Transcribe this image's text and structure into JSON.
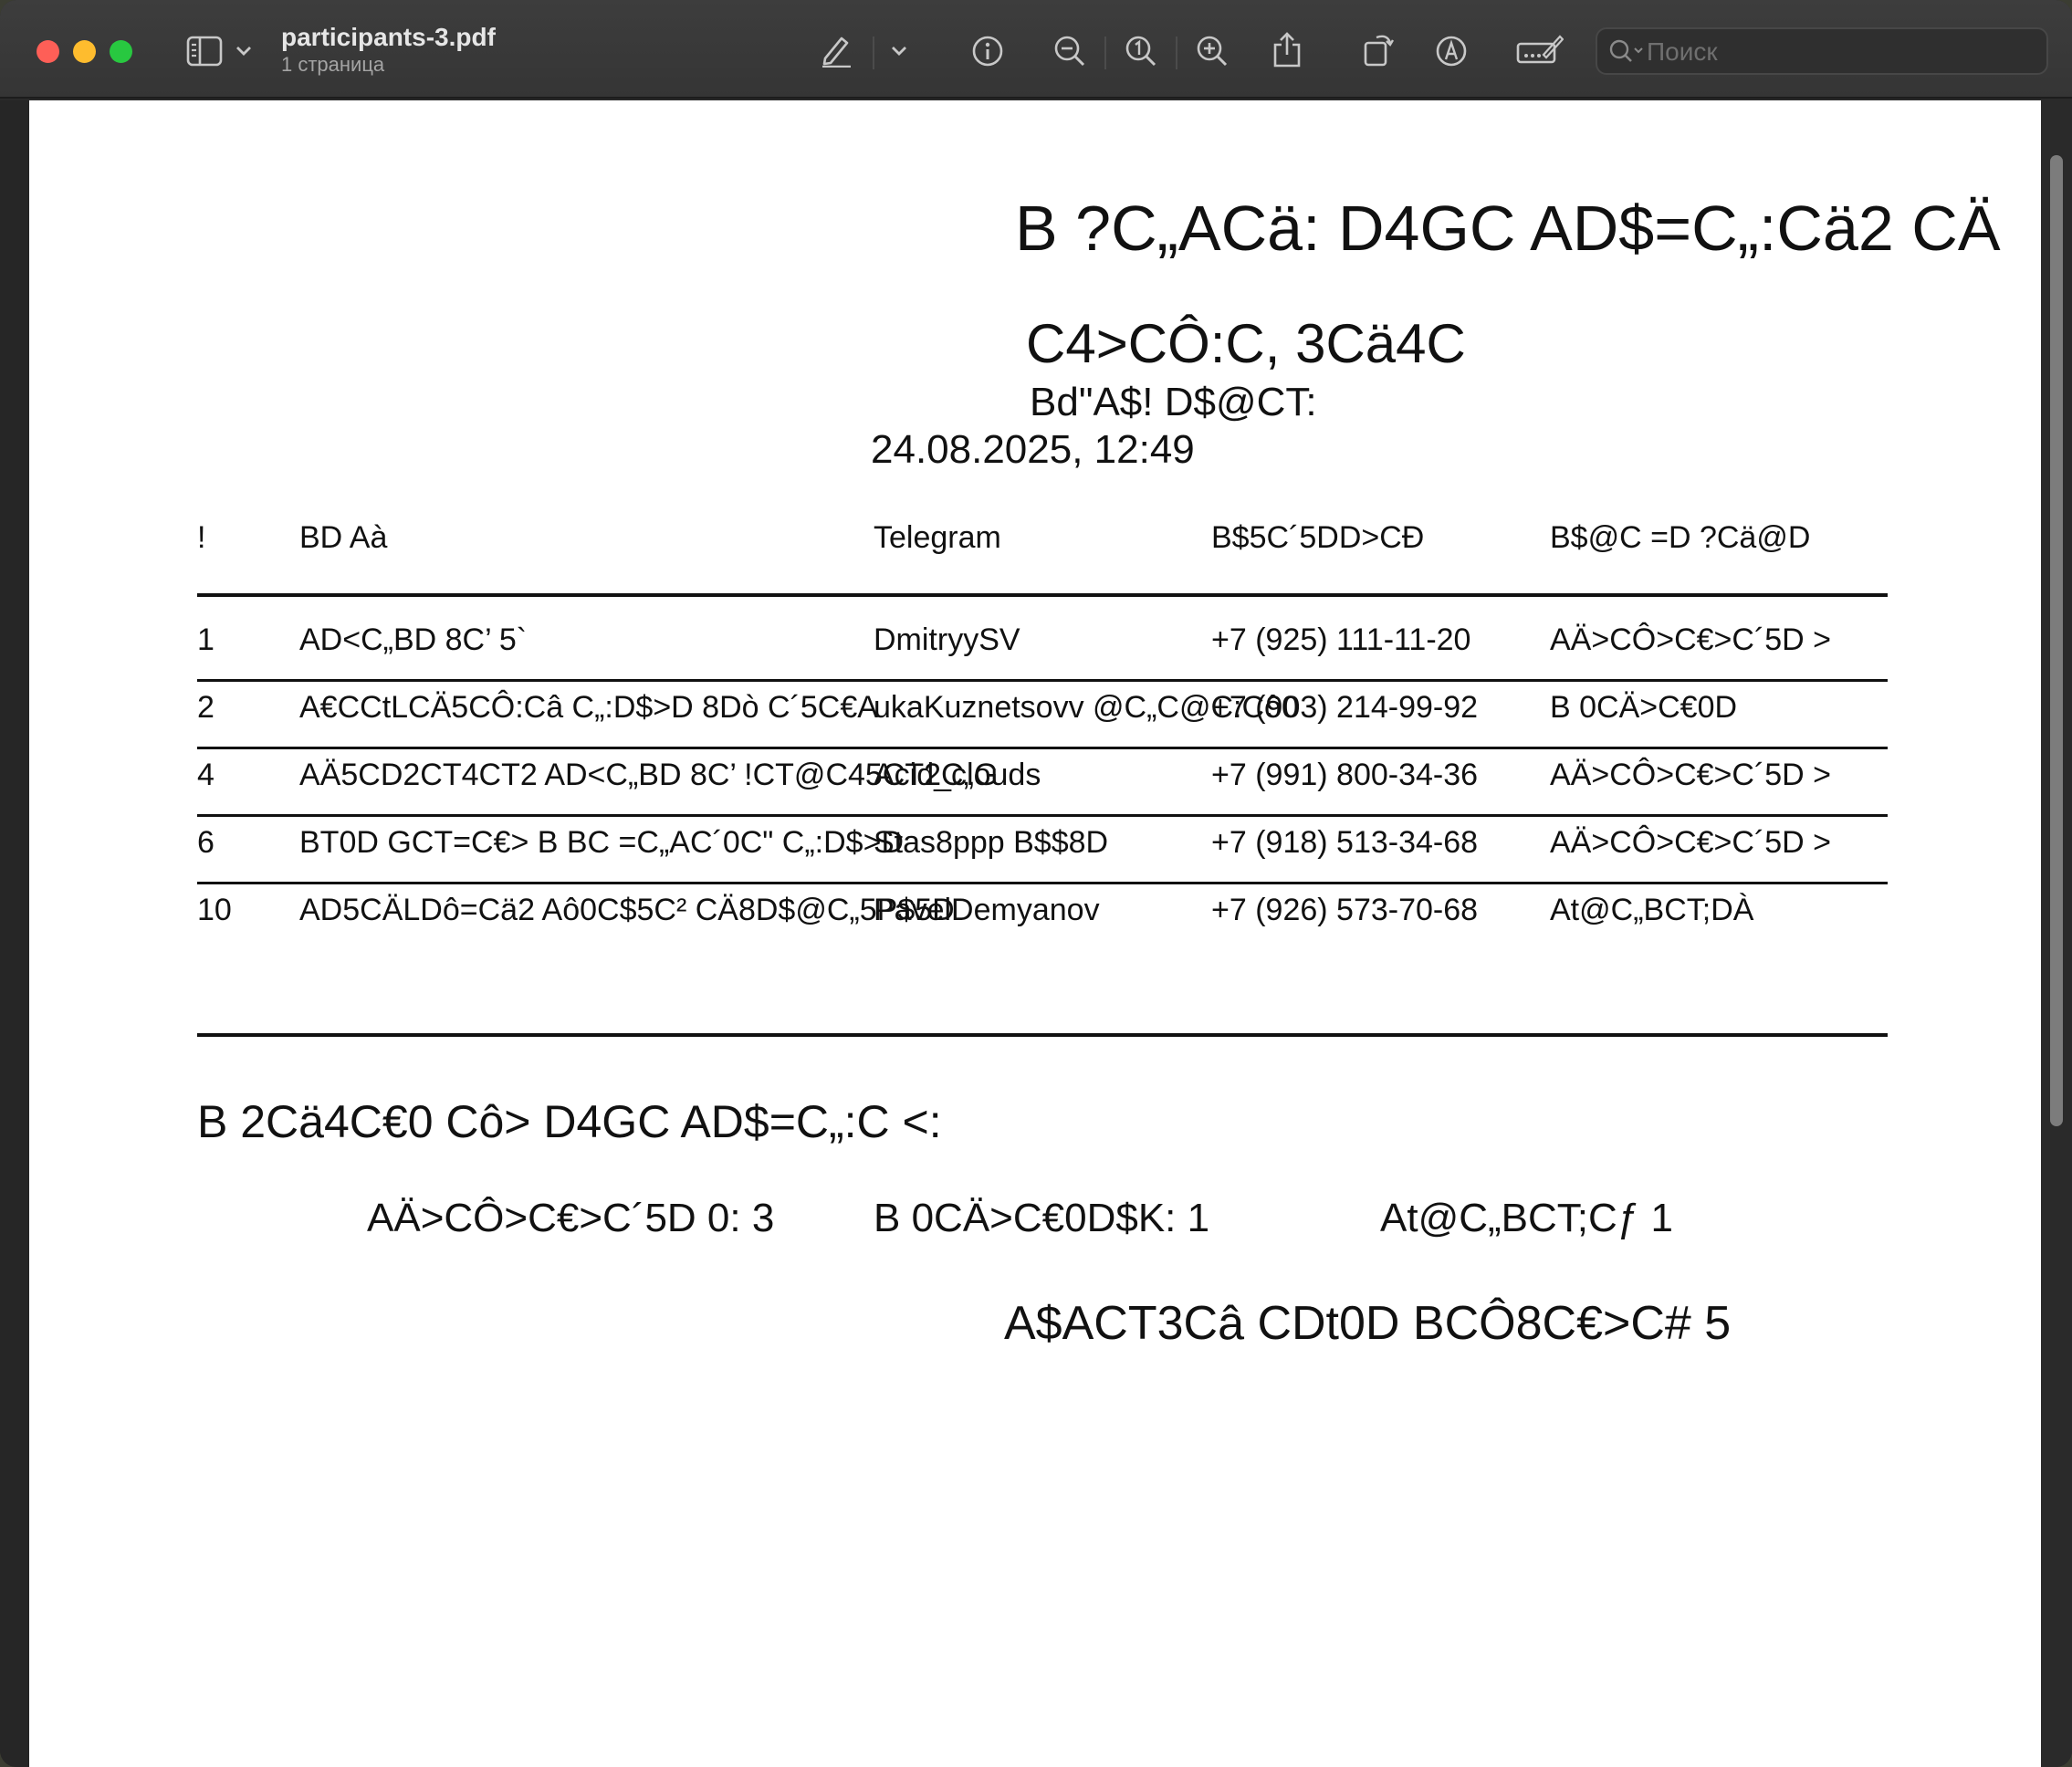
{
  "window": {
    "doc_title": "participants-3.pdf",
    "doc_subtitle": "1 страница"
  },
  "search": {
    "placeholder": "Поиск"
  },
  "toolbar_icons": [
    "sidebar-icon",
    "chevron-down-icon",
    "markup-pen-icon",
    "chevron-down-icon",
    "info-icon",
    "zoom-out-icon",
    "actual-size-icon",
    "zoom-in-icon",
    "share-icon",
    "rotate-icon",
    "markup-icon",
    "form-fill-icon"
  ],
  "document": {
    "title": "B ?C„ACä: D4GC AD$=C„:Cä2 CÄ",
    "subtitle": "C4>CÔ:C, 3Cä4C",
    "generated_label": "Bd\"A$! D$@CT:",
    "generated_datetime": "24.08.2025, 12:49",
    "table": {
      "headers": [
        "!",
        "BD Aà",
        "Telegram",
        "B$5C´5DD>CĐ",
        "B$@C =D ?Cä@D"
      ],
      "rows": [
        [
          "1",
          "AD<C„BD 8C’ 5`",
          "DmitryySV",
          "+7 (925) 111-11-20",
          "AÄ>CÔ>C€>C´5D >"
        ],
        [
          "2",
          "A€CCtLCÄ5CÔ:Câ  C„:D$>D 8Dò  C´5C€A",
          "ukaKuznetsovv  @C„C@C:Cô0",
          "+7 (903) 214-99-92",
          "B 0CÄ>C€0D"
        ],
        [
          "4",
          "AÄ5CD2CT4CT2 AD<C„BD 8C’ !CT@C45CT2C„G",
          "Acid_clouds",
          "+7 (991) 800-34-36",
          "AÄ>CÔ>C€>C´5D >"
        ],
        [
          "6",
          "BT0D GCT=C€> B BC =C„AC´0C\"  C„:D$>D",
          "Stas8ppp  B$$8D",
          "+7 (918) 513-34-68",
          "AÄ>CÔ>C€>C´5D >"
        ],
        [
          "10",
          "AD5CÄLDô=Cä2 Aô0C$5C²  CÄ8D$@C„5P$5D",
          "PavelDemyanov",
          "+7 (926) 573-70-68",
          "At@C„BCT;DÀ"
        ]
      ]
    },
    "summary": {
      "title": "B 2Cä4C€0 Cô> D4GC AD$=C„:C <:",
      "stats": [
        "AÄ>CÔ>C€>C´5D 0: 3",
        "B 0CÄ>C€0D$K: 1",
        "At@C„BCT;Cƒ  1"
      ],
      "total": "A$ACT3Câ CDt0D BCÔ8C€>C#  5"
    }
  }
}
